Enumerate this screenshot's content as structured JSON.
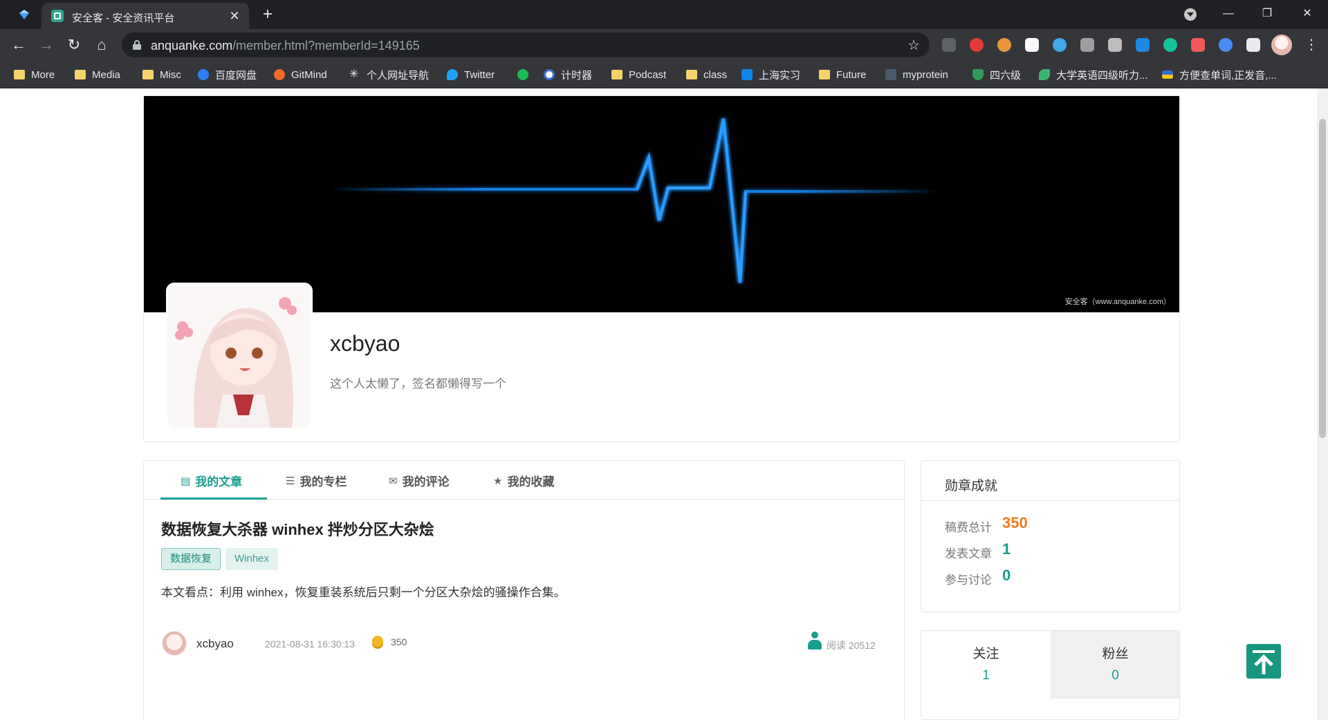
{
  "browser": {
    "tab_title": "安全客 - 安全资讯平台",
    "url_host": "anquanke.com",
    "url_rest": "/member.html?memberId=149165",
    "icons": {
      "back": "back-arrow-icon",
      "forward": "forward-arrow-icon",
      "reload": "reload-icon",
      "home": "home-icon"
    }
  },
  "bookmarks": [
    {
      "label": "More",
      "icon": "folder-icon"
    },
    {
      "label": "Media",
      "icon": "folder-icon"
    },
    {
      "label": "Misc",
      "icon": "folder-icon"
    },
    {
      "label": "百度网盘",
      "icon": "baidu-pan-icon"
    },
    {
      "label": "GitMind",
      "icon": "gitmind-icon"
    },
    {
      "label": "个人网址导航",
      "icon": "snowflake-icon"
    },
    {
      "label": "Twitter",
      "icon": "twitter-icon"
    },
    {
      "label": "",
      "icon": "phone-icon"
    },
    {
      "label": "计时器",
      "icon": "clock-icon"
    },
    {
      "label": "Podcast",
      "icon": "folder-icon"
    },
    {
      "label": "class",
      "icon": "folder-icon"
    },
    {
      "label": "上海实习",
      "icon": "zhihu-icon"
    },
    {
      "label": "Future",
      "icon": "folder-icon"
    },
    {
      "label": "myprotein",
      "icon": "myprotein-icon"
    },
    {
      "label": "四六级",
      "icon": "shield-icon"
    },
    {
      "label": "大学英语四级听力...",
      "icon": "leaf-icon"
    },
    {
      "label": "方便查单词,正发音,...",
      "icon": "flag-icon"
    }
  ],
  "profile": {
    "username": "xcbyao",
    "signature": "这个人太懒了，签名都懒得写一个",
    "banner_watermark": "安全客（www.anquanke.com）"
  },
  "tabs": [
    {
      "label": "我的文章",
      "icon": "article-icon",
      "active": true
    },
    {
      "label": "我的专栏",
      "icon": "list-icon",
      "active": false
    },
    {
      "label": "我的评论",
      "icon": "comment-icon",
      "active": false
    },
    {
      "label": "我的收藏",
      "icon": "star-icon",
      "active": false
    }
  ],
  "article": {
    "title": "数据恢复大杀器 winhex 拌炒分区大杂烩",
    "tags": [
      "数据恢复",
      "Winhex"
    ],
    "summary": "本文看点：利用 winhex，恢复重装系统后只剩一个分区大杂烩的骚操作合集。",
    "author": "xcbyao",
    "time": "2021-08-31 16:30:13",
    "coins": "350",
    "reads": "阅读 20512"
  },
  "achievements": {
    "title": "勋章成就",
    "items": [
      {
        "label": "稿费总计",
        "value": "350",
        "color": "#f07a1a"
      },
      {
        "label": "发表文章",
        "value": "1",
        "color": "#1a9e8f"
      },
      {
        "label": "参与讨论",
        "value": "0",
        "color": "#1a9e8f"
      }
    ]
  },
  "follow": {
    "following_label": "关注",
    "following_count": "1",
    "fans_label": "粉丝",
    "fans_count": "0"
  },
  "colors": {
    "accent": "#1a9e8f",
    "fee": "#f07a1a",
    "banner_line": "#1a8cff"
  }
}
